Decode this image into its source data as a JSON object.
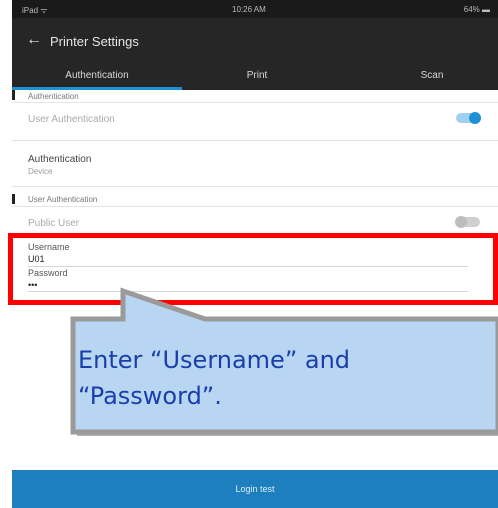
{
  "status_bar": {
    "carrier": "iPad ᯤ",
    "time": "10:26 AM",
    "battery": "64% ▬"
  },
  "header": {
    "title": "Printer Settings"
  },
  "tabs": [
    {
      "label": "Authentication",
      "active": true
    },
    {
      "label": "Print",
      "active": false
    },
    {
      "label": "Scan",
      "active": false
    }
  ],
  "sections": {
    "authentication": {
      "heading": "Authentication",
      "user_auth_label": "User Authentication",
      "user_auth_enabled": true,
      "method_label": "Authentication",
      "method_value": "Device"
    },
    "user_authentication": {
      "heading": "User Authentication",
      "public_user_label": "Public User",
      "public_user_enabled": false,
      "username_label": "Username",
      "username_value": "U01",
      "password_label": "Password",
      "password_value": "•••"
    }
  },
  "bottom_bar": {
    "label": "Login test"
  },
  "callout": {
    "line1": "Enter “Username” and",
    "line2": "“Password”."
  },
  "colors": {
    "accent": "#1e90d6",
    "header": "#262626",
    "highlight": "#ff0000",
    "callout_fill": "#b8d6f2",
    "callout_text": "#1a3faa"
  }
}
